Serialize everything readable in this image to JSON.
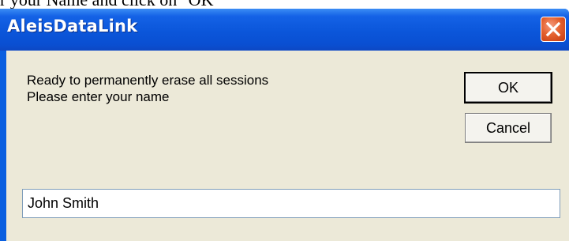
{
  "document": {
    "text": "r your Name and click on \"OK\""
  },
  "dialog": {
    "title": "AleisDataLink",
    "close_icon": "close-icon",
    "message_lines": [
      "Ready to permanently erase all sessions",
      "Please enter your name"
    ],
    "ok_label": "OK",
    "cancel_label": "Cancel",
    "name_value": "John Smith"
  },
  "colors": {
    "titlebar": "#0a56da",
    "dialog_face": "#ece9d8",
    "close_button": "#e4612f"
  }
}
